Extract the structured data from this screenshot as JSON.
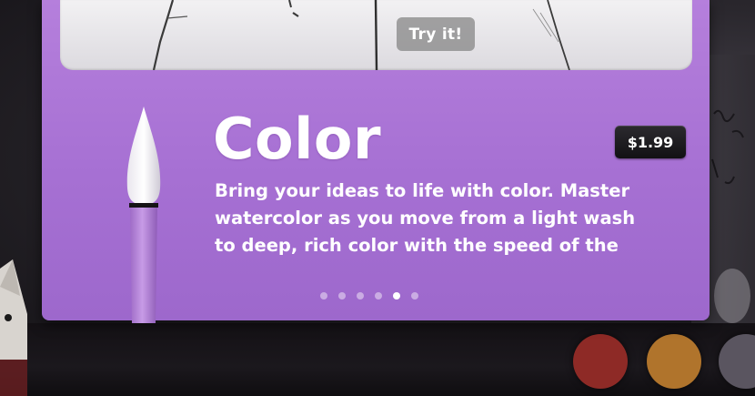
{
  "preview": {
    "try_label": "Try it!"
  },
  "product": {
    "title": "Color",
    "price": "$1.99",
    "description": "Bring your ideas to life with color. Master\nwatercolor as you move from a light wash\nto deep, rich color with the speed of the",
    "tool_icon": "watercolor-brush-icon"
  },
  "pager": {
    "page_count": 6,
    "active_index": 4
  },
  "palette": {
    "swatches": [
      "#8e2a26",
      "#b0742c",
      "#5a5560"
    ]
  },
  "colors": {
    "card": "#a670d3",
    "price_badge": "#1c1a1e",
    "button": "#8a8a8a"
  }
}
